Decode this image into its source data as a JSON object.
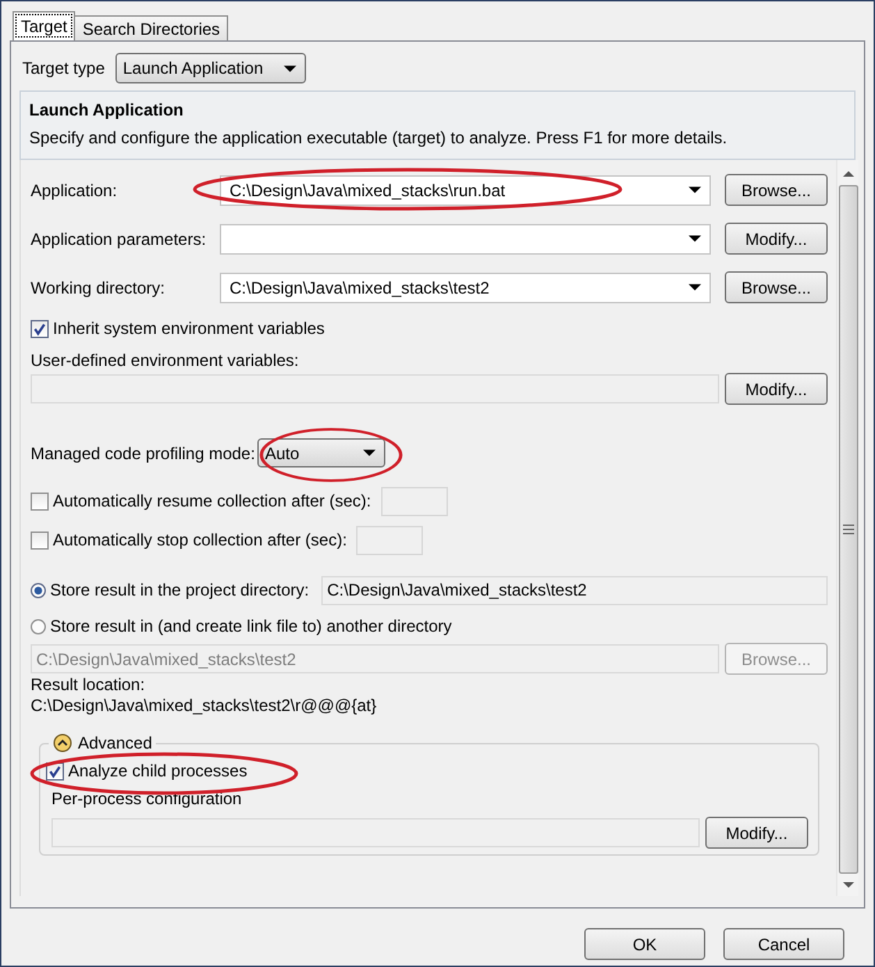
{
  "tabs": [
    {
      "label": "Target",
      "selected": true
    },
    {
      "label": "Search Directories",
      "selected": false
    }
  ],
  "target_type": {
    "label": "Target type",
    "value": "Launch Application"
  },
  "header": {
    "title": "Launch Application",
    "description": "Specify and configure the application executable (target) to analyze. Press F1 for more details."
  },
  "fields": [
    {
      "label": "Application:",
      "value": "C:\\Design\\Java\\mixed_stacks\\run.bat",
      "button": "Browse...",
      "highlighted": true
    },
    {
      "label": "Application parameters:",
      "button": "Modify...",
      "highlighted": false
    },
    {
      "label": "Working directory:",
      "value": "C:\\Design\\Java\\mixed_stacks\\test2",
      "button": "Browse...",
      "highlighted": false
    }
  ],
  "inherit_env": {
    "label": "Inherit system environment variables",
    "checked": true
  },
  "user_env": {
    "label": "User-defined environment variables:",
    "button": "Modify..."
  },
  "profiling_mode": {
    "label": "Managed code profiling mode:",
    "value": "Auto",
    "highlighted": true
  },
  "timers": [
    {
      "label": "Automatically resume collection after (sec):",
      "checked": false
    },
    {
      "label": "Automatically stop collection after (sec):",
      "checked": false
    }
  ],
  "store_options": [
    {
      "label": "Store result in the project directory:",
      "selected": true,
      "value": "C:\\Design\\Java\\mixed_stacks\\test2"
    },
    {
      "label": "Store result in (and create link file to) another directory",
      "selected": false
    }
  ],
  "other_dir": {
    "value": "C:\\Design\\Java\\mixed_stacks\\test2",
    "button": "Browse...",
    "disabled": true
  },
  "result_location": {
    "label": "Result location:",
    "value": "C:\\Design\\Java\\mixed_stacks\\test2\\r@@@{at}"
  },
  "advanced": {
    "title": "Advanced",
    "expanded": true,
    "analyze_child": {
      "label": "Analyze child processes",
      "checked": true,
      "highlighted": true
    },
    "per_process": {
      "label": "Per-process configuration",
      "button": "Modify..."
    }
  },
  "buttons": [
    "OK",
    "Cancel"
  ]
}
